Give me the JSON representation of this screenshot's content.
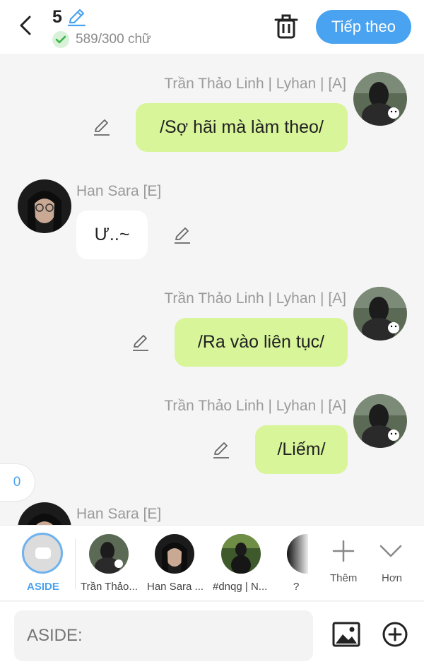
{
  "header": {
    "chapter_number": "5",
    "word_count": "589/300 chữ",
    "next_label": "Tiếp theo"
  },
  "messages": [
    {
      "speaker": "Trần Thảo Linh | Lyhan | [A]",
      "text": "/Sợ hãi mà làm theo/",
      "side": "right"
    },
    {
      "speaker": "Han Sara [E]",
      "text": "Ư..~",
      "side": "left"
    },
    {
      "speaker": "Trần Thảo Linh | Lyhan | [A]",
      "text": "/Ra vào liên tục/",
      "side": "right"
    },
    {
      "speaker": "Trần Thảo Linh | Lyhan | [A]",
      "text": "/Liếm/",
      "side": "right"
    },
    {
      "speaker": "Han Sara [E]",
      "text": "",
      "side": "left"
    }
  ],
  "side_tab": {
    "count": "0"
  },
  "characters": {
    "aside_label": "ASIDE",
    "items": [
      {
        "label": "Trần Thảo..."
      },
      {
        "label": "Han Sara ..."
      },
      {
        "label": "#dnqg | N..."
      },
      {
        "label": "?"
      }
    ],
    "add_label": "Thêm",
    "more_label": "Hơn"
  },
  "composer": {
    "placeholder": "ASIDE:"
  },
  "colors": {
    "accent": "#4aa3f0",
    "bubble_green": "#d8f59a"
  }
}
